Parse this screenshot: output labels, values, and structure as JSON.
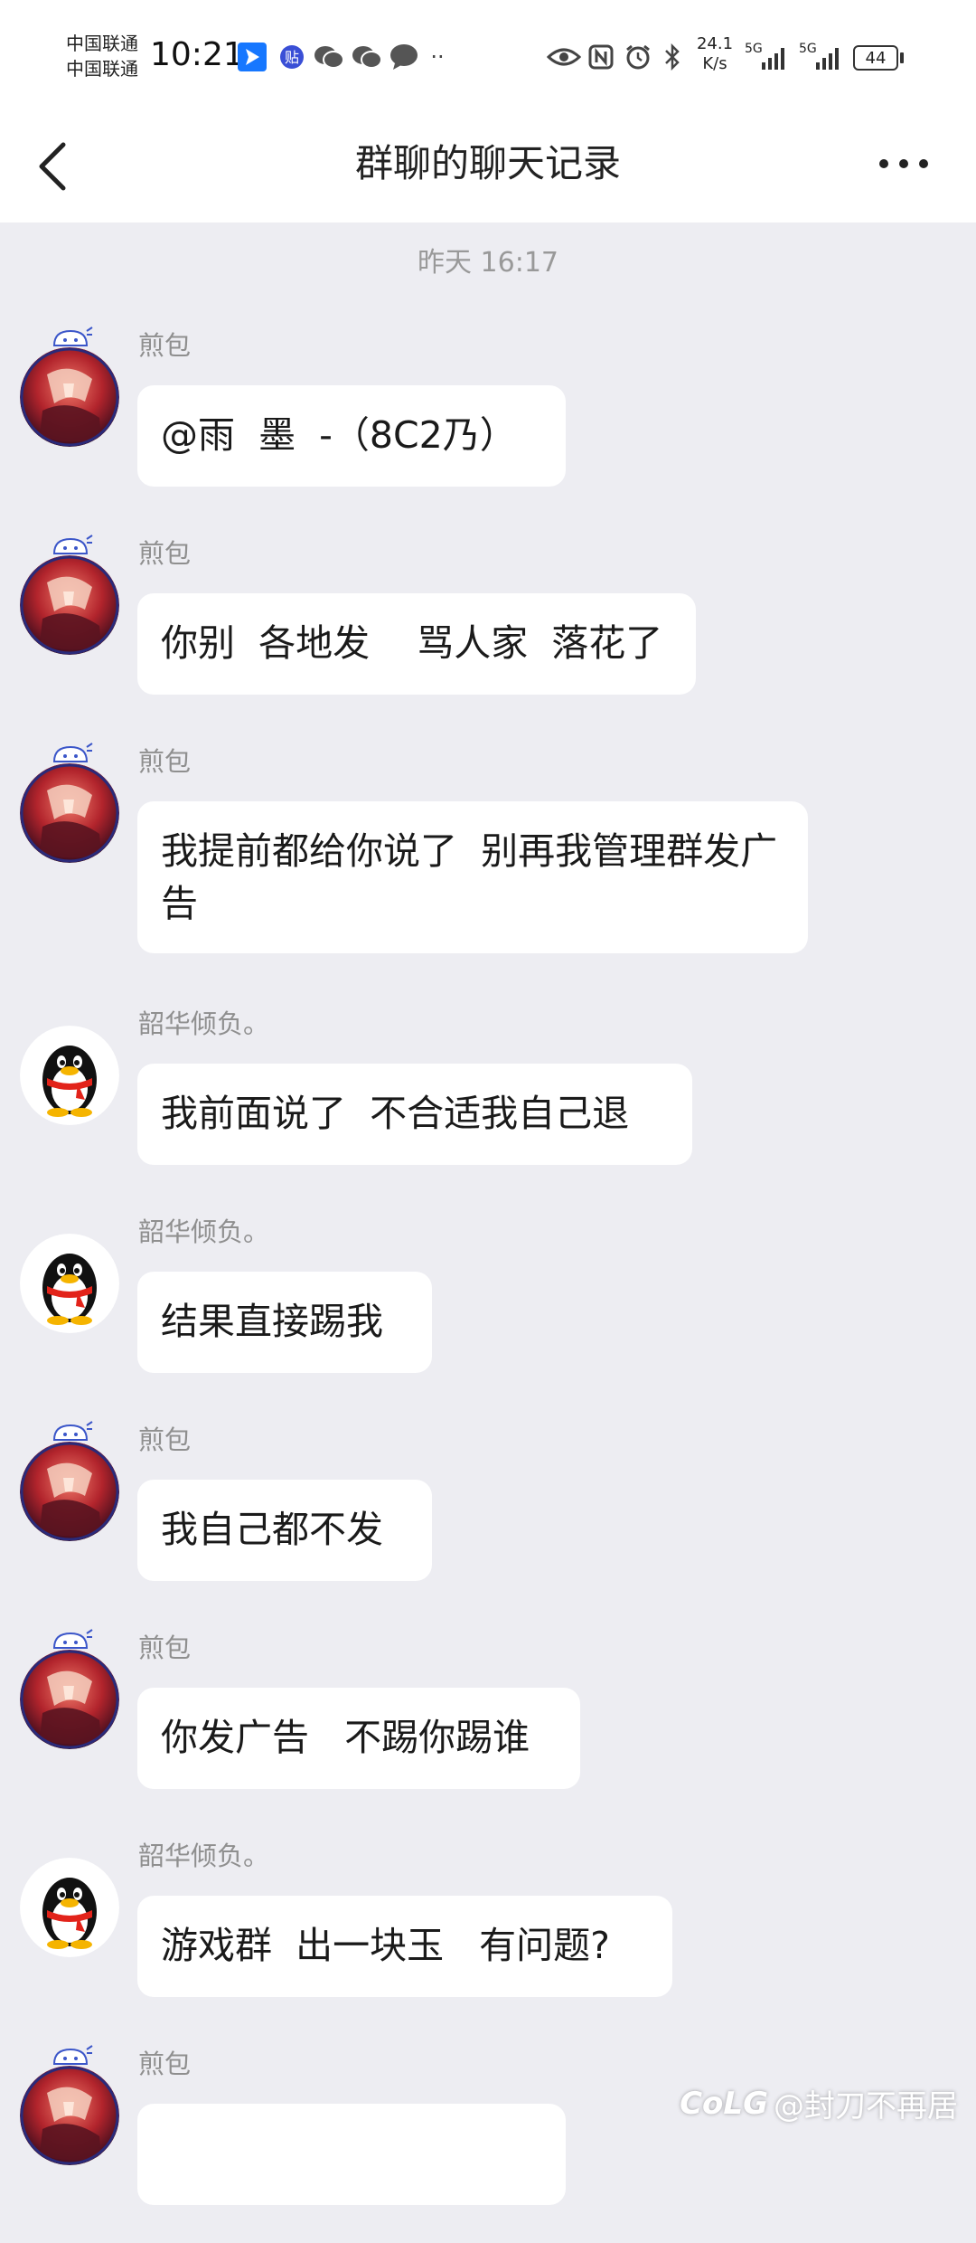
{
  "status_bar": {
    "carrier_1": "中国联通",
    "carrier_2": "中国联通",
    "time": "10:21",
    "app_icons": [
      "paper-plane-app-icon",
      "tieba-app-icon",
      "wechat-icon",
      "wechat-icon",
      "message-icon",
      "more-notifications-icon"
    ],
    "tieba_label": "贴",
    "more_dots": "··",
    "system_icons": [
      "eye-icon",
      "nfc-icon",
      "alarm-icon",
      "bluetooth-icon"
    ],
    "net_speed_value": "24.1",
    "net_speed_unit": "K/s",
    "signal_1_label": "5G",
    "signal_2_label": "5G",
    "battery": "44"
  },
  "nav": {
    "title": "群聊的聊天记录",
    "back_icon": "chevron-left-icon",
    "more_icon": "more-dots-icon"
  },
  "chat": {
    "timestamp": "昨天 16:17",
    "messages": [
      {
        "sender": "煎包",
        "avatar": "anime-avatar",
        "text": "@雨  墨  -（8C2乃）"
      },
      {
        "sender": "煎包",
        "avatar": "anime-avatar",
        "text": "你别  各地发    骂人家  落花了"
      },
      {
        "sender": "煎包",
        "avatar": "anime-avatar",
        "text": "我提前都给你说了  别再我管理群发广告"
      },
      {
        "sender": "韶华倾负。",
        "avatar": "qq-penguin-avatar",
        "text": "我前面说了  不合适我自己退"
      },
      {
        "sender": "韶华倾负。",
        "avatar": "qq-penguin-avatar",
        "text": "结果直接踢我"
      },
      {
        "sender": "煎包",
        "avatar": "anime-avatar",
        "text": "我自己都不发"
      },
      {
        "sender": "煎包",
        "avatar": "anime-avatar",
        "text": "你发广告   不踢你踢谁"
      },
      {
        "sender": "韶华倾负。",
        "avatar": "qq-penguin-avatar",
        "text": "游戏群  出一块玉   有问题?"
      },
      {
        "sender": "煎包",
        "avatar": "anime-avatar",
        "text": ""
      }
    ]
  },
  "watermark": {
    "logo": "CoLG",
    "text": "@封刀不再居"
  }
}
